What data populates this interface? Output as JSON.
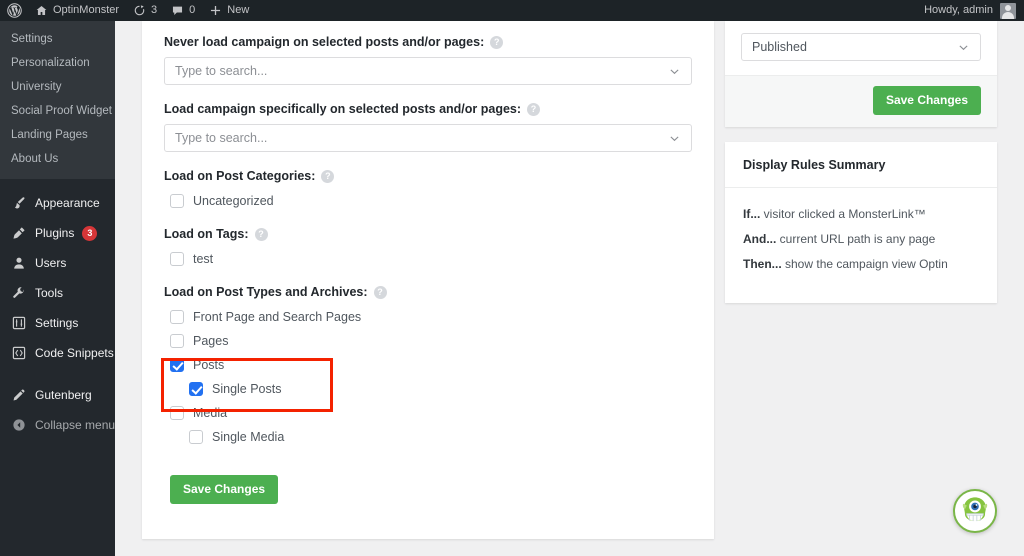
{
  "adminbar": {
    "logo_icon": "wordpress-logo-icon",
    "site_icon": "home-icon",
    "site_name": "OptinMonster",
    "updates_icon": "updates-icon",
    "updates_count": "3",
    "comments_icon": "comment-bubble-icon",
    "comments_count": "0",
    "new_icon": "plus-icon",
    "new_label": "New",
    "howdy": "Howdy, admin",
    "avatar_icon": "avatar-icon"
  },
  "sidebar": {
    "submenu": [
      {
        "label": "Settings"
      },
      {
        "label": "Personalization"
      },
      {
        "label": "University"
      },
      {
        "label": "Social Proof Widget"
      },
      {
        "label": "Landing Pages"
      },
      {
        "label": "About Us"
      }
    ],
    "menu": [
      {
        "label": "Appearance",
        "icon": "paintbrush-icon"
      },
      {
        "label": "Plugins",
        "icon": "plug-icon",
        "badge": "3"
      },
      {
        "label": "Users",
        "icon": "user-icon"
      },
      {
        "label": "Tools",
        "icon": "wrench-icon"
      },
      {
        "label": "Settings",
        "icon": "sliders-icon"
      },
      {
        "label": "Code Snippets",
        "icon": "code-brackets-icon"
      }
    ],
    "menu_extra": [
      {
        "label": "Gutenberg",
        "icon": "pencil-icon"
      },
      {
        "label": "Collapse menu",
        "icon": "collapse-arrow-icon"
      }
    ]
  },
  "main": {
    "never_load": {
      "label": "Never load campaign on selected posts and/or pages:",
      "help_icon": "help-icon",
      "placeholder": "Type to search...",
      "value": "",
      "chevron_icon": "chevron-down-icon"
    },
    "load_specifically": {
      "label": "Load campaign specifically on selected posts and/or pages:",
      "help_icon": "help-icon",
      "placeholder": "Type to search...",
      "value": "",
      "chevron_icon": "chevron-down-icon"
    },
    "post_categories": {
      "label": "Load on Post Categories:",
      "help_icon": "help-icon",
      "items": [
        {
          "label": "Uncategorized",
          "checked": false,
          "indent": false
        }
      ]
    },
    "tags": {
      "label": "Load on Tags:",
      "help_icon": "help-icon",
      "items": [
        {
          "label": "test",
          "checked": false,
          "indent": false
        }
      ]
    },
    "post_types": {
      "label": "Load on Post Types and Archives:",
      "help_icon": "help-icon",
      "items": [
        {
          "label": "Front Page and Search Pages",
          "checked": false,
          "indent": false
        },
        {
          "label": "Pages",
          "checked": false,
          "indent": false
        },
        {
          "label": "Posts",
          "checked": true,
          "indent": false
        },
        {
          "label": "Single Posts",
          "checked": true,
          "indent": true
        },
        {
          "label": "Media",
          "checked": false,
          "indent": false
        },
        {
          "label": "Single Media",
          "checked": false,
          "indent": true
        }
      ]
    },
    "save_label": "Save Changes"
  },
  "right": {
    "status_select": {
      "value": "Published",
      "chevron_icon": "chevron-down-icon"
    },
    "save_label": "Save Changes",
    "summary_title": "Display Rules Summary",
    "rules": [
      {
        "prefix": "If...",
        "text": " visitor clicked a MonsterLink™"
      },
      {
        "prefix": "And...",
        "text": " current URL path is any page"
      },
      {
        "prefix": "Then...",
        "text": " show the campaign view Optin"
      }
    ]
  },
  "mascot": {
    "icon": "optinmonster-mascot-icon"
  },
  "colors": {
    "accent_green": "#4caf50",
    "checkbox_blue": "#2271f1",
    "highlight_red": "#f42200",
    "sidebar_dark": "#23282d",
    "badge_red": "#d63638"
  }
}
